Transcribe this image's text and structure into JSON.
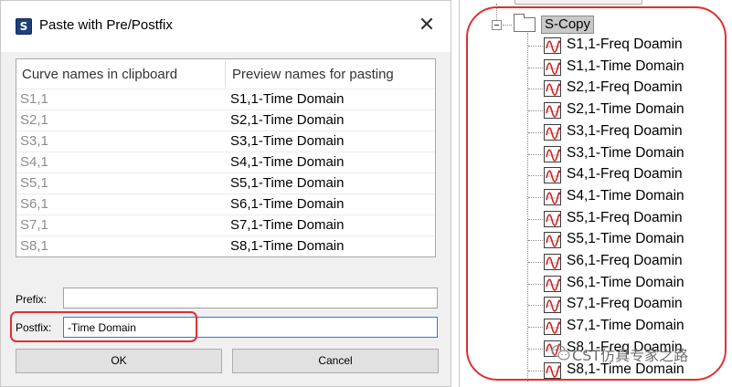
{
  "dialog": {
    "app_icon_letter": "S",
    "title": "Paste with Pre/Postfix",
    "close_glyph": "✕",
    "list": {
      "headers": [
        "Curve names in clipboard",
        "Preview names for pasting"
      ],
      "rows": [
        {
          "clipboard": "S1,1",
          "preview": "S1,1-Time Domain"
        },
        {
          "clipboard": "S2,1",
          "preview": "S2,1-Time Domain"
        },
        {
          "clipboard": "S3,1",
          "preview": "S3,1-Time Domain"
        },
        {
          "clipboard": "S4,1",
          "preview": "S4,1-Time Domain"
        },
        {
          "clipboard": "S5,1",
          "preview": "S5,1-Time Domain"
        },
        {
          "clipboard": "S6,1",
          "preview": "S6,1-Time Domain"
        },
        {
          "clipboard": "S7,1",
          "preview": "S7,1-Time Domain"
        },
        {
          "clipboard": "S8,1",
          "preview": "S8,1-Time Domain"
        }
      ]
    },
    "prefix": {
      "label": "Prefix:",
      "value": ""
    },
    "postfix": {
      "label": "Postfix:",
      "value": "-Time Domain"
    },
    "buttons": {
      "ok": "OK",
      "cancel": "Cancel"
    }
  },
  "tree": {
    "folder": {
      "label": "S-Copy",
      "icon": "folder-icon"
    },
    "item_icon": "signal-curve-icon",
    "items": [
      "S1,1-Freq Doamin",
      "S1,1-Time Domain",
      "S2,1-Freq Doamin",
      "S2,1-Time Domain",
      "S3,1-Freq Doamin",
      "S3,1-Time Domain",
      "S4,1-Freq Doamin",
      "S4,1-Time Domain",
      "S5,1-Freq Doamin",
      "S5,1-Time Domain",
      "S6,1-Freq Doamin",
      "S6,1-Time Domain",
      "S7,1-Freq Doamin",
      "S7,1-Time Domain",
      "S8,1-Freq Doamin",
      "S8,1-Time Domain"
    ]
  },
  "watermark": {
    "icon": "wechat-icon",
    "text": "CST仿真专家之路"
  },
  "colors": {
    "highlight": "#e03030",
    "focus_border": "#2a7de1",
    "clipboard_text": "#8c8c8c",
    "app_icon_bg": "#1d3f7a"
  }
}
